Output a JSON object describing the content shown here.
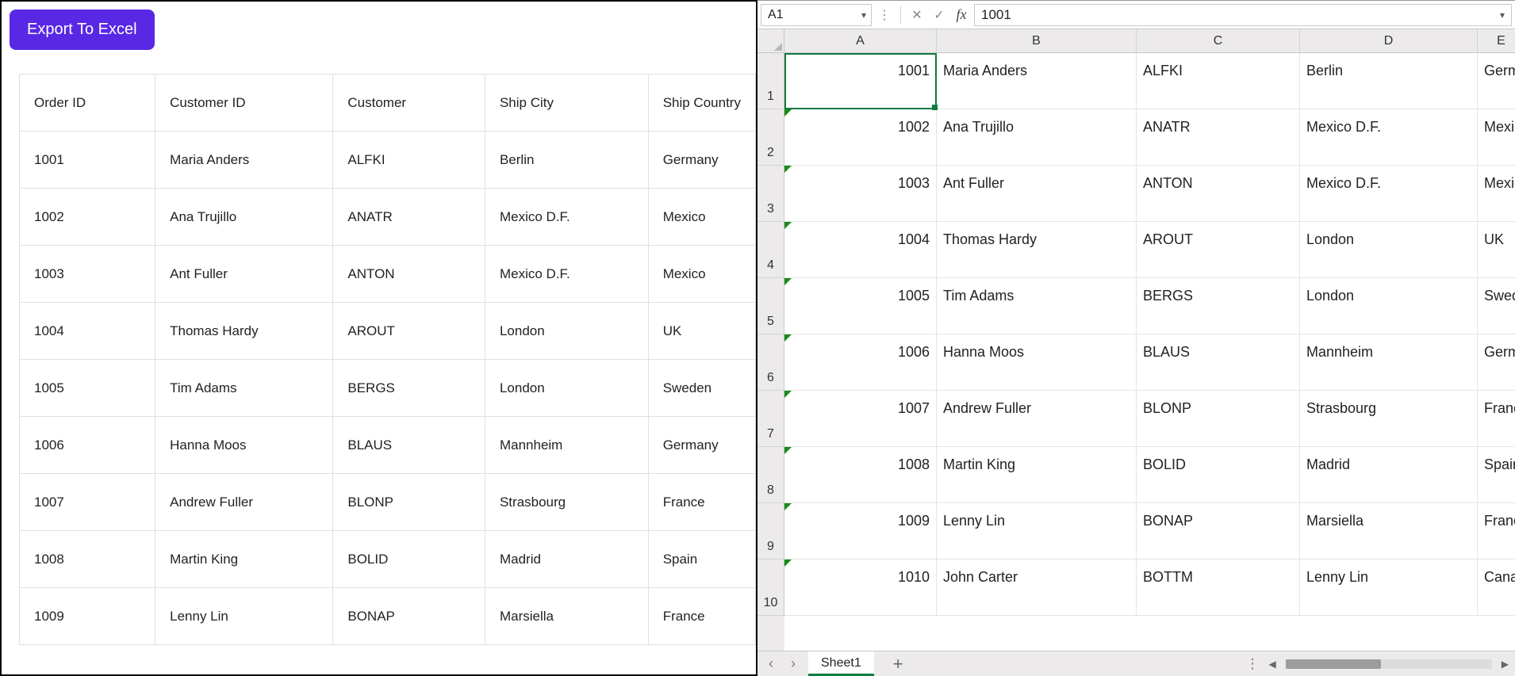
{
  "left": {
    "exportLabel": "Export To Excel",
    "columns": [
      "Order ID",
      "Customer ID",
      "Customer",
      "Ship City",
      "Ship Country"
    ],
    "rows": [
      {
        "orderId": "1001",
        "custId": "Maria Anders",
        "cust": "ALFKI",
        "city": "Berlin",
        "country": "Germany"
      },
      {
        "orderId": "1002",
        "custId": "Ana Trujillo",
        "cust": "ANATR",
        "city": "Mexico D.F.",
        "country": "Mexico"
      },
      {
        "orderId": "1003",
        "custId": "Ant Fuller",
        "cust": "ANTON",
        "city": "Mexico D.F.",
        "country": "Mexico"
      },
      {
        "orderId": "1004",
        "custId": "Thomas Hardy",
        "cust": "AROUT",
        "city": "London",
        "country": "UK"
      },
      {
        "orderId": "1005",
        "custId": "Tim Adams",
        "cust": "BERGS",
        "city": "London",
        "country": "Sweden"
      },
      {
        "orderId": "1006",
        "custId": "Hanna Moos",
        "cust": "BLAUS",
        "city": "Mannheim",
        "country": "Germany"
      },
      {
        "orderId": "1007",
        "custId": "Andrew Fuller",
        "cust": "BLONP",
        "city": "Strasbourg",
        "country": "France"
      },
      {
        "orderId": "1008",
        "custId": "Martin King",
        "cust": "BOLID",
        "city": "Madrid",
        "country": "Spain"
      },
      {
        "orderId": "1009",
        "custId": "Lenny Lin",
        "cust": "BONAP",
        "city": "Marsiella",
        "country": "France"
      }
    ]
  },
  "sheet": {
    "nameBox": "A1",
    "formulaValue": "1001",
    "colHeaders": [
      "A",
      "B",
      "C",
      "D",
      "E"
    ],
    "rowHeaders": [
      "1",
      "2",
      "3",
      "4",
      "5",
      "6",
      "7",
      "8",
      "9",
      "10"
    ],
    "rows": [
      {
        "a": "1001",
        "b": "Maria Anders",
        "c": "ALFKI",
        "d": "Berlin",
        "e": "Germany"
      },
      {
        "a": "1002",
        "b": "Ana Trujillo",
        "c": "ANATR",
        "d": "Mexico D.F.",
        "e": "Mexico"
      },
      {
        "a": "1003",
        "b": "Ant Fuller",
        "c": "ANTON",
        "d": "Mexico D.F.",
        "e": "Mexico"
      },
      {
        "a": "1004",
        "b": "Thomas Hardy",
        "c": "AROUT",
        "d": "London",
        "e": "UK"
      },
      {
        "a": "1005",
        "b": "Tim Adams",
        "c": "BERGS",
        "d": "London",
        "e": "Sweden"
      },
      {
        "a": "1006",
        "b": "Hanna Moos",
        "c": "BLAUS",
        "d": "Mannheim",
        "e": "Germany"
      },
      {
        "a": "1007",
        "b": "Andrew Fuller",
        "c": "BLONP",
        "d": "Strasbourg",
        "e": "France"
      },
      {
        "a": "1008",
        "b": "Martin King",
        "c": "BOLID",
        "d": "Madrid",
        "e": "Spain"
      },
      {
        "a": "1009",
        "b": "Lenny Lin",
        "c": "BONAP",
        "d": "Marsiella",
        "e": "France"
      },
      {
        "a": "1010",
        "b": "John Carter",
        "c": "BOTTM",
        "d": "Lenny Lin",
        "e": "Canada"
      }
    ],
    "tabName": "Sheet1"
  }
}
